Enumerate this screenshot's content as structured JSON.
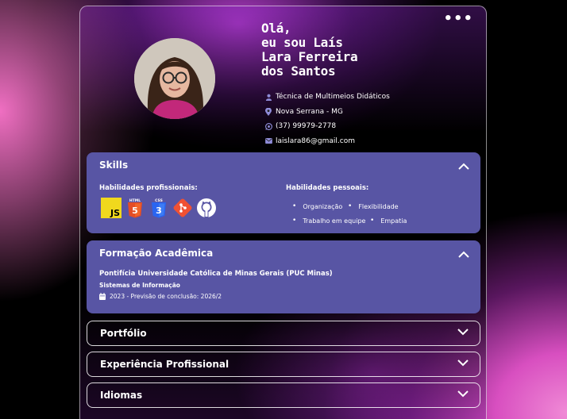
{
  "header": {
    "greeting_lines": [
      "Olá,",
      "eu sou Laís",
      "Lara Ferreira",
      "dos Santos"
    ],
    "info": [
      {
        "icon": "person-icon",
        "text": "Técnica de Multimeios Didáticos"
      },
      {
        "icon": "location-pin-icon",
        "text": "Nova Serrana - MG"
      },
      {
        "icon": "whatsapp-icon",
        "text": "(37) 99979-2778"
      },
      {
        "icon": "mail-icon",
        "text": "laislara86@gmail.com"
      }
    ]
  },
  "skills": {
    "title": "Skills",
    "professional_label": "Habilidades profissionais:",
    "personal_label": "Habilidades pessoais:",
    "tech_icons": [
      "javascript-icon",
      "html5-icon",
      "css3-icon",
      "git-icon",
      "github-icon"
    ],
    "personal": [
      "Organização",
      "Flexibilidade",
      "Trabalho em equipe",
      "Empatia"
    ]
  },
  "education": {
    "title": "Formação Acadêmica",
    "institution": "Pontifícia Universidade Católica de Minas Gerais (PUC Minas)",
    "course": "Sistemas de Informação",
    "period": "2023 - Previsão de conclusão: 2026/2"
  },
  "sections": [
    {
      "title": "Portfólio"
    },
    {
      "title": "Experiência Profissional"
    },
    {
      "title": "Idiomas"
    }
  ],
  "colors": {
    "panel": "#5855a4",
    "js": "#f0d81d",
    "html": "#e44d26",
    "css": "#2965f1",
    "git": "#f05133"
  }
}
